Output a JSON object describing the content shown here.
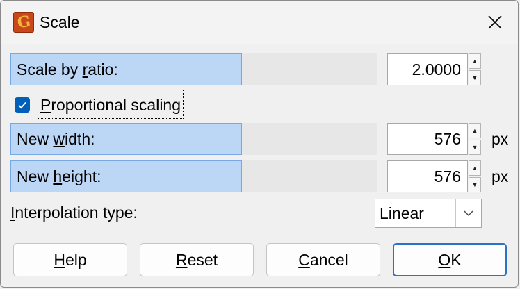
{
  "window": {
    "title": "Scale",
    "app_icon_letter": "G",
    "app_icon_color": "#c9481a"
  },
  "rows": {
    "ratio": {
      "label_pre": "Scale by ",
      "label_key": "r",
      "label_post": "atio:",
      "value": "2.0000"
    },
    "width": {
      "label_pre": "New ",
      "label_key": "w",
      "label_post": "idth:",
      "value": "576",
      "unit": "px"
    },
    "height": {
      "label_pre": "New ",
      "label_key": "h",
      "label_post": "eight:",
      "value": "576",
      "unit": "px"
    }
  },
  "proportional": {
    "label_key": "P",
    "label_rest": "roportional scaling",
    "checked": true
  },
  "interpolation": {
    "label_key": "I",
    "label_rest": "nterpolation type:",
    "selected": "Linear"
  },
  "buttons": {
    "help": {
      "key": "H",
      "rest": "elp"
    },
    "reset": {
      "key": "R",
      "rest": "eset"
    },
    "cancel": {
      "key": "C",
      "rest": "ancel"
    },
    "ok": {
      "key": "O",
      "rest": "K"
    }
  },
  "colors": {
    "accent": "#005fb8",
    "row_highlight": "#bcd6f6",
    "default_button_border": "#2c73c8"
  }
}
